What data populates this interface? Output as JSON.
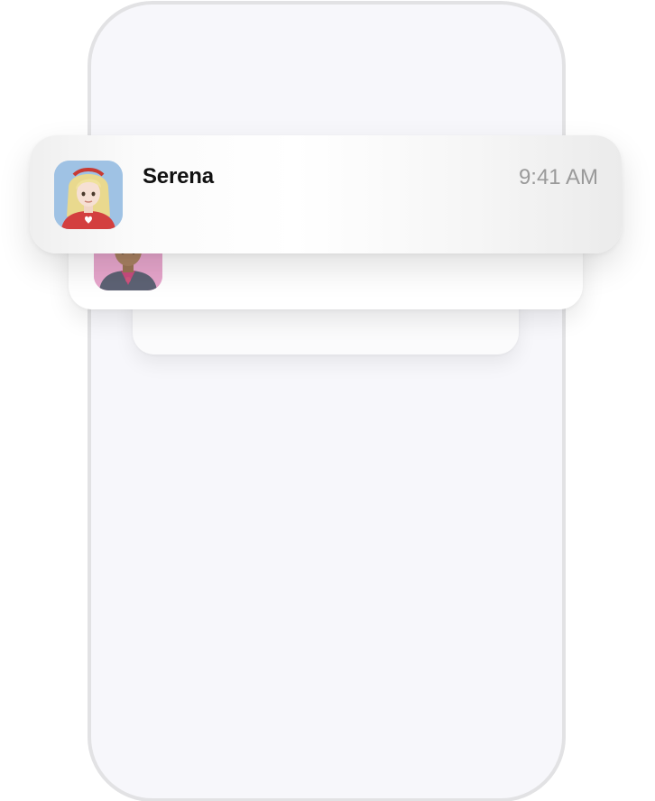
{
  "notification": {
    "sender": "Serena",
    "time": "9:41 AM",
    "avatar_icon": "memoji-woman-blonde-red-shirt",
    "avatar_bg": "#9fc2e4"
  },
  "stacked_notification": {
    "avatar_icon": "memoji-man-pink-background",
    "avatar_bg": "#e7a6cc"
  }
}
